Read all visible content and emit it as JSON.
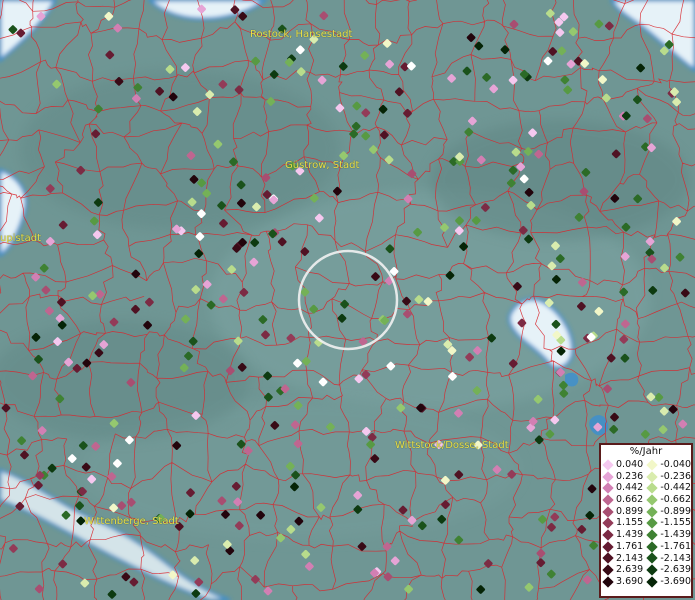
{
  "map": {
    "cities": [
      {
        "name": "Rostock, Hansestadt"
      },
      {
        "name": "Güstrow, Stadt"
      },
      {
        "name": "Wittstock/Dosse, Stadt"
      },
      {
        "name": "Wittenberge, Stadt"
      },
      {
        "name": "upistadt"
      }
    ],
    "colors": {
      "land": "#6f9694",
      "water": "#e6f2f8",
      "water_edge": "#3c8fd0",
      "borders": "#d8262c",
      "legend_border": "#5a1b1b",
      "label": "#e8e04a"
    }
  },
  "legend": {
    "title": "%/Jahr",
    "positive": [
      {
        "label": "0.040",
        "color": "#f5c8ef"
      },
      {
        "label": "0.236",
        "color": "#e6a4d6"
      },
      {
        "label": "0.442",
        "color": "#d27fb3"
      },
      {
        "label": "0.662",
        "color": "#bf6690"
      },
      {
        "label": "0.899",
        "color": "#a84e71"
      },
      {
        "label": "1.155",
        "color": "#933b58"
      },
      {
        "label": "1.439",
        "color": "#7c2b44"
      },
      {
        "label": "1.761",
        "color": "#661c32"
      },
      {
        "label": "2.143",
        "color": "#4f1223"
      },
      {
        "label": "2.639",
        "color": "#380a16"
      },
      {
        "label": "3.690",
        "color": "#22040c"
      }
    ],
    "negative": [
      {
        "label": "-0.040",
        "color": "#f2f7c8"
      },
      {
        "label": "-0.236",
        "color": "#d9ecae"
      },
      {
        "label": "-0.442",
        "color": "#b8dc8c"
      },
      {
        "label": "-0.662",
        "color": "#95c86f"
      },
      {
        "label": "-0.899",
        "color": "#74b157"
      },
      {
        "label": "-1.155",
        "color": "#579a43"
      },
      {
        "label": "-1.439",
        "color": "#3f8233"
      },
      {
        "label": "-1.761",
        "color": "#2b6a26"
      },
      {
        "label": "-2.143",
        "color": "#1a521b"
      },
      {
        "label": "-2.639",
        "color": "#0d3a10"
      },
      {
        "label": "-3.690",
        "color": "#052406"
      }
    ]
  }
}
